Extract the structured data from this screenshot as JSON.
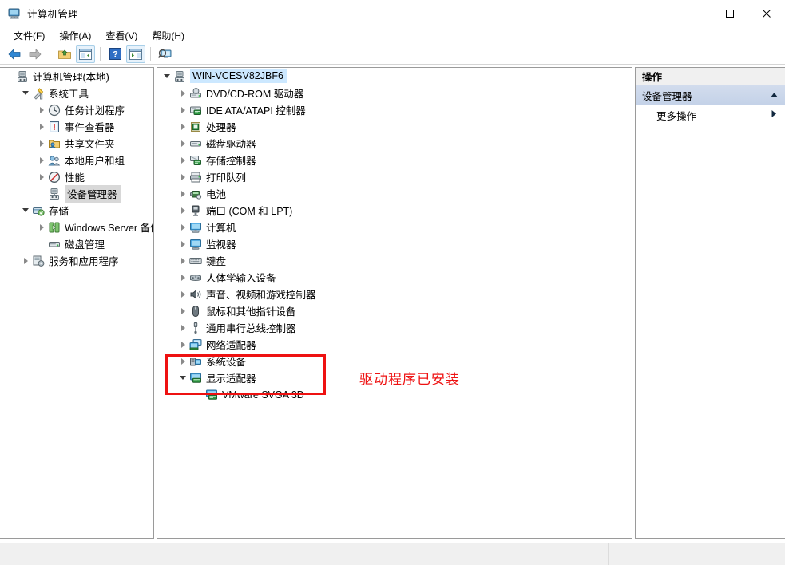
{
  "window": {
    "title": "计算机管理",
    "app_icon": "computer-management-icon",
    "controls": {
      "minimize": "minimize-icon",
      "maximize": "maximize-icon",
      "close": "close-icon"
    }
  },
  "menubar": {
    "items": [
      {
        "label": "文件(F)",
        "name": "menu-file"
      },
      {
        "label": "操作(A)",
        "name": "menu-action"
      },
      {
        "label": "查看(V)",
        "name": "menu-view"
      },
      {
        "label": "帮助(H)",
        "name": "menu-help"
      }
    ]
  },
  "toolbar": {
    "buttons": [
      {
        "icon": "back-arrow-icon",
        "framed": false
      },
      {
        "icon": "forward-arrow-icon",
        "framed": false
      },
      {
        "icon": "up-folder-icon",
        "framed": false
      },
      {
        "icon": "show-hide-console-tree-icon",
        "framed": true
      },
      {
        "icon": "help-icon",
        "framed": false
      },
      {
        "icon": "show-hide-action-pane-icon",
        "framed": true
      },
      {
        "icon": "scan-hardware-changes-icon",
        "framed": false
      }
    ]
  },
  "left_tree": {
    "nodes": [
      {
        "label": "计算机管理(本地)",
        "indent": 0,
        "expander": "none",
        "icon": "computer-management-icon",
        "selected": "none"
      },
      {
        "label": "系统工具",
        "indent": 1,
        "expander": "expanded",
        "icon": "system-tools-icon",
        "selected": "none"
      },
      {
        "label": "任务计划程序",
        "indent": 2,
        "expander": "collapsed",
        "icon": "task-scheduler-icon",
        "selected": "none"
      },
      {
        "label": "事件查看器",
        "indent": 2,
        "expander": "collapsed",
        "icon": "event-viewer-icon",
        "selected": "none"
      },
      {
        "label": "共享文件夹",
        "indent": 2,
        "expander": "collapsed",
        "icon": "shared-folders-icon",
        "selected": "none"
      },
      {
        "label": "本地用户和组",
        "indent": 2,
        "expander": "collapsed",
        "icon": "local-users-groups-icon",
        "selected": "none"
      },
      {
        "label": "性能",
        "indent": 2,
        "expander": "collapsed",
        "icon": "performance-icon",
        "selected": "none"
      },
      {
        "label": "设备管理器",
        "indent": 2,
        "expander": "none",
        "icon": "device-manager-icon",
        "selected": "gray"
      },
      {
        "label": "存储",
        "indent": 1,
        "expander": "expanded",
        "icon": "storage-icon",
        "selected": "none"
      },
      {
        "label": "Windows Server 备份",
        "indent": 2,
        "expander": "collapsed",
        "icon": "windows-server-backup-icon",
        "selected": "none"
      },
      {
        "label": "磁盘管理",
        "indent": 2,
        "expander": "none",
        "icon": "disk-management-icon",
        "selected": "none"
      },
      {
        "label": "服务和应用程序",
        "indent": 1,
        "expander": "collapsed",
        "icon": "services-applications-icon",
        "selected": "none"
      }
    ]
  },
  "device_tree": {
    "nodes": [
      {
        "label": "WIN-VCESV82JBF6",
        "indent": 0,
        "expander": "expanded",
        "icon": "computer-root-icon",
        "selected": "blue"
      },
      {
        "label": "DVD/CD-ROM 驱动器",
        "indent": 1,
        "expander": "collapsed",
        "icon": "dvd-cdrom-icon",
        "selected": "none"
      },
      {
        "label": "IDE ATA/ATAPI 控制器",
        "indent": 1,
        "expander": "collapsed",
        "icon": "ide-controller-icon",
        "selected": "none"
      },
      {
        "label": "处理器",
        "indent": 1,
        "expander": "collapsed",
        "icon": "processor-icon",
        "selected": "none"
      },
      {
        "label": "磁盘驱动器",
        "indent": 1,
        "expander": "collapsed",
        "icon": "disk-drive-icon",
        "selected": "none"
      },
      {
        "label": "存储控制器",
        "indent": 1,
        "expander": "collapsed",
        "icon": "storage-controller-icon",
        "selected": "none"
      },
      {
        "label": "打印队列",
        "indent": 1,
        "expander": "collapsed",
        "icon": "print-queue-icon",
        "selected": "none"
      },
      {
        "label": "电池",
        "indent": 1,
        "expander": "collapsed",
        "icon": "battery-icon",
        "selected": "none"
      },
      {
        "label": "端口 (COM 和 LPT)",
        "indent": 1,
        "expander": "collapsed",
        "icon": "ports-icon",
        "selected": "none"
      },
      {
        "label": "计算机",
        "indent": 1,
        "expander": "collapsed",
        "icon": "computer-icon",
        "selected": "none"
      },
      {
        "label": "监视器",
        "indent": 1,
        "expander": "collapsed",
        "icon": "monitor-icon",
        "selected": "none"
      },
      {
        "label": "键盘",
        "indent": 1,
        "expander": "collapsed",
        "icon": "keyboard-icon",
        "selected": "none"
      },
      {
        "label": "人体学输入设备",
        "indent": 1,
        "expander": "collapsed",
        "icon": "hid-icon",
        "selected": "none"
      },
      {
        "label": "声音、视频和游戏控制器",
        "indent": 1,
        "expander": "collapsed",
        "icon": "sound-video-game-icon",
        "selected": "none"
      },
      {
        "label": "鼠标和其他指针设备",
        "indent": 1,
        "expander": "collapsed",
        "icon": "mouse-icon",
        "selected": "none"
      },
      {
        "label": "通用串行总线控制器",
        "indent": 1,
        "expander": "collapsed",
        "icon": "usb-controller-icon",
        "selected": "none"
      },
      {
        "label": "网络适配器",
        "indent": 1,
        "expander": "collapsed",
        "icon": "network-adapter-icon",
        "selected": "none"
      },
      {
        "label": "系统设备",
        "indent": 1,
        "expander": "collapsed",
        "icon": "system-devices-icon",
        "selected": "none"
      },
      {
        "label": "显示适配器",
        "indent": 1,
        "expander": "expanded",
        "icon": "display-adapter-icon",
        "selected": "none"
      },
      {
        "label": "VMware SVGA 3D",
        "indent": 2,
        "expander": "none",
        "icon": "display-adapter-icon",
        "selected": "none"
      }
    ]
  },
  "actions_pane": {
    "header": "操作",
    "section_title": "设备管理器",
    "collapse_icon": "chevron-up-icon",
    "items": [
      {
        "label": "更多操作",
        "submenu_icon": "chevron-right-icon"
      }
    ]
  },
  "annotations": {
    "highlight_box_name": "display-adapter-highlight-box",
    "note_text": "驱动程序已安装",
    "color": "#ee1111"
  },
  "statusbar": {
    "text": ""
  }
}
